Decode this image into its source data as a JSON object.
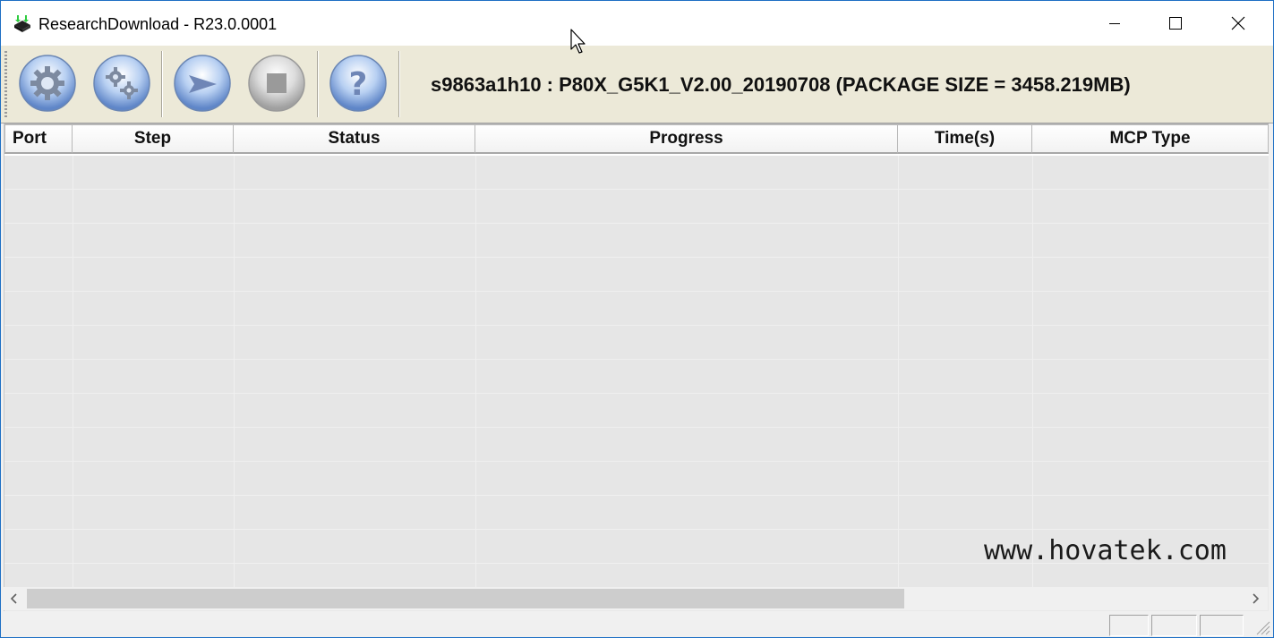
{
  "window": {
    "title": "ResearchDownload - R23.0.0001",
    "controls": {
      "minimize": "minimize",
      "maximize": "maximize",
      "close": "close"
    }
  },
  "toolbar": {
    "buttons": [
      {
        "name": "load-packet-button",
        "icon": "gear-icon"
      },
      {
        "name": "settings-button",
        "icon": "gears-icon"
      },
      {
        "name": "start-download-button",
        "icon": "play-arrow-icon"
      },
      {
        "name": "stop-download-button",
        "icon": "stop-icon"
      },
      {
        "name": "help-button",
        "icon": "question-icon"
      }
    ],
    "package_info": "s9863a1h10 : P80X_G5K1_V2.00_20190708 (PACKAGE SIZE = 3458.219MB)"
  },
  "list": {
    "columns": [
      "Port",
      "Step",
      "Status",
      "Progress",
      "Time(s)",
      "MCP Type"
    ],
    "rows": []
  },
  "watermark": "www.hovatek.com",
  "colors": {
    "toolbar_bg": "#ece9d8",
    "list_bg": "#e6e6e6",
    "window_border": "#1e6fc4"
  }
}
